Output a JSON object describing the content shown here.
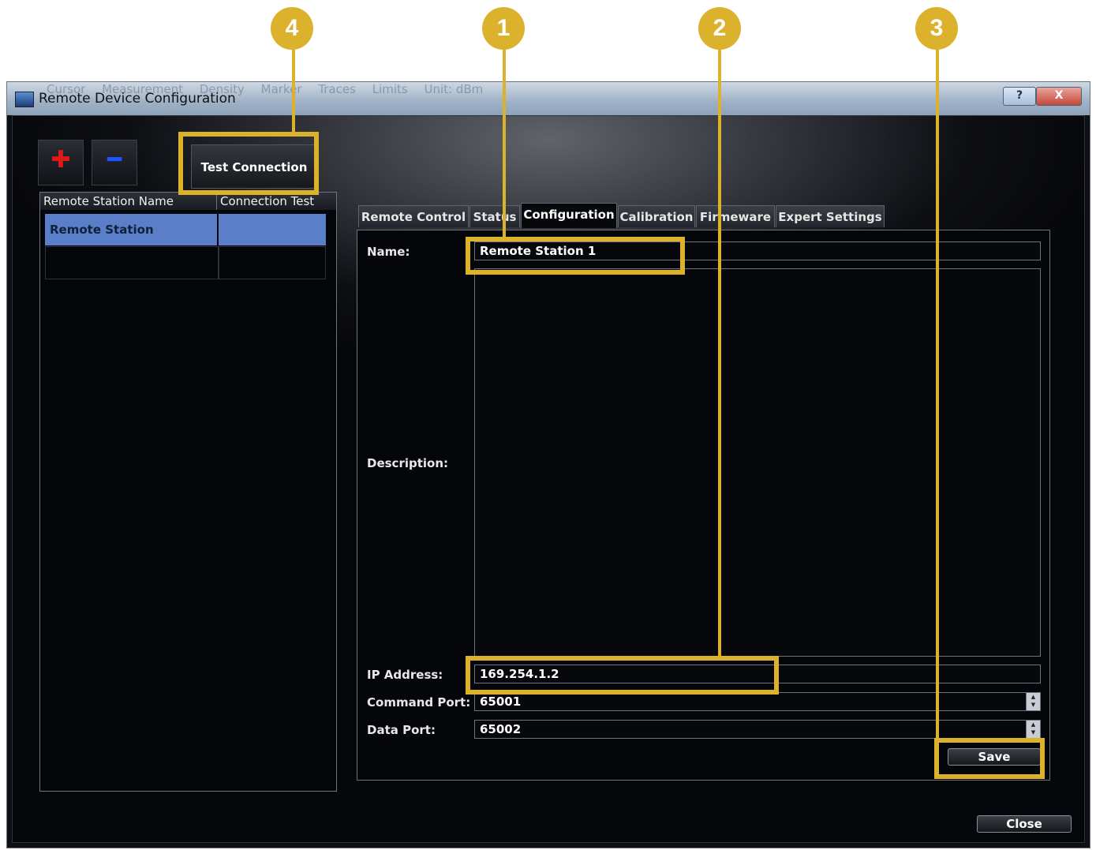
{
  "window": {
    "title": "Remote Device Configuration",
    "help_label": "?",
    "close_label": "X",
    "background_menu": [
      "Cursor",
      "Measurement",
      "Density",
      "Marker",
      "Traces",
      "Limits",
      "Unit: dBm"
    ]
  },
  "toolbar": {
    "add_icon": "plus-icon",
    "remove_icon": "minus-icon",
    "add_glyph": "✚",
    "remove_glyph": "━",
    "test_connection_label": "Test Connection"
  },
  "station_list": {
    "columns": [
      "Remote Station Name",
      "Connection Test"
    ],
    "rows": [
      {
        "name": "Remote Station",
        "connection_test": ""
      }
    ]
  },
  "tabs": [
    "Remote Control",
    "Status",
    "Configuration",
    "Calibration",
    "Firmeware",
    "Expert Settings"
  ],
  "active_tab": "Configuration",
  "form": {
    "name_label": "Name:",
    "name_value": "Remote Station 1",
    "description_label": "Description:",
    "description_value": "",
    "ip_label": "IP Address:",
    "ip_value": "169.254.1.2",
    "command_port_label": "Command Port:",
    "command_port_value": "65001",
    "data_port_label": "Data Port:",
    "data_port_value": "65002",
    "save_label": "Save"
  },
  "footer": {
    "close_label": "Close"
  },
  "callouts": [
    "1",
    "2",
    "3",
    "4"
  ],
  "colors": {
    "callout": "#dcb22c",
    "selected_row": "#5a7ec8"
  }
}
